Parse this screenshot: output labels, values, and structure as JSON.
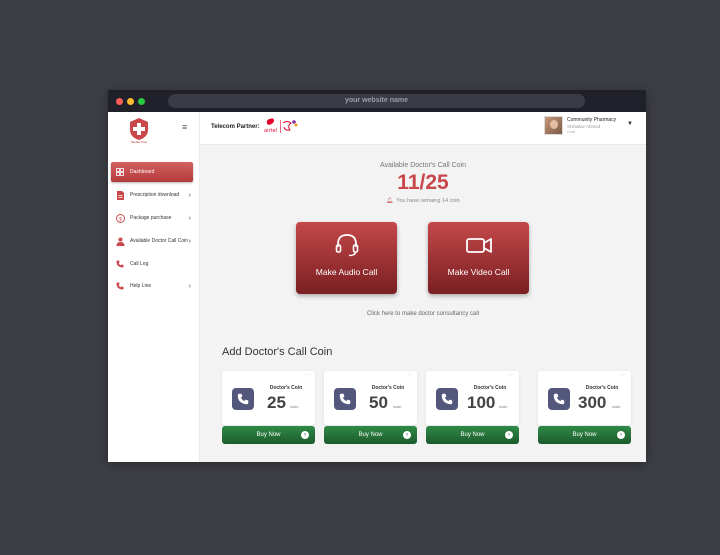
{
  "browser": {
    "url": "your website name"
  },
  "sidebar": {
    "logo_text": "MedEx Plus",
    "items": [
      {
        "label": "Dashboard",
        "icon": "grid-icon",
        "active": true,
        "chevron": false
      },
      {
        "label": "Prescription download",
        "icon": "document-icon",
        "active": false,
        "chevron": true
      },
      {
        "label": "Package purchase",
        "icon": "dollar-circle-icon",
        "active": false,
        "chevron": true
      },
      {
        "label": "Available Doctor Call Coin",
        "icon": "doctor-icon",
        "active": false,
        "chevron": true
      },
      {
        "label": "Call Log",
        "icon": "phone-icon",
        "active": false,
        "chevron": false
      },
      {
        "label": "Help Line",
        "icon": "phone-icon",
        "active": false,
        "chevron": true
      }
    ]
  },
  "header": {
    "partner_label": "Telecom Partner:",
    "partner_logo_text": "airtel",
    "user": {
      "name": "Community Pharmacy",
      "sub": "Shihabur Ahmed",
      "role": "Code"
    }
  },
  "coins": {
    "label": "Available Doctor's Call Coin",
    "count": "11/25",
    "remaining": "You have remaing 14 coin"
  },
  "actions": {
    "audio_label": "Make Audio Call",
    "video_label": "Make Video Call",
    "consult_link": "Click here to make doctor consultancy call"
  },
  "add_coin": {
    "title": "Add Doctor's Call Coin",
    "cards": [
      {
        "category": "Doctor's Coin",
        "amount": "25",
        "unit": "/coin",
        "button": "Buy Now"
      },
      {
        "category": "Doctor's Coin",
        "amount": "50",
        "unit": "/coin",
        "button": "Buy Now"
      },
      {
        "category": "Doctor's Coin",
        "amount": "100",
        "unit": "/coin",
        "button": "Buy Now"
      },
      {
        "category": "Doctor's Coin",
        "amount": "300",
        "unit": "/coin",
        "button": "Buy Now"
      }
    ]
  },
  "colors": {
    "brand_red": "#c9474a",
    "buy_green": "#2f8b47",
    "coin_icon_bg": "#53577c"
  }
}
